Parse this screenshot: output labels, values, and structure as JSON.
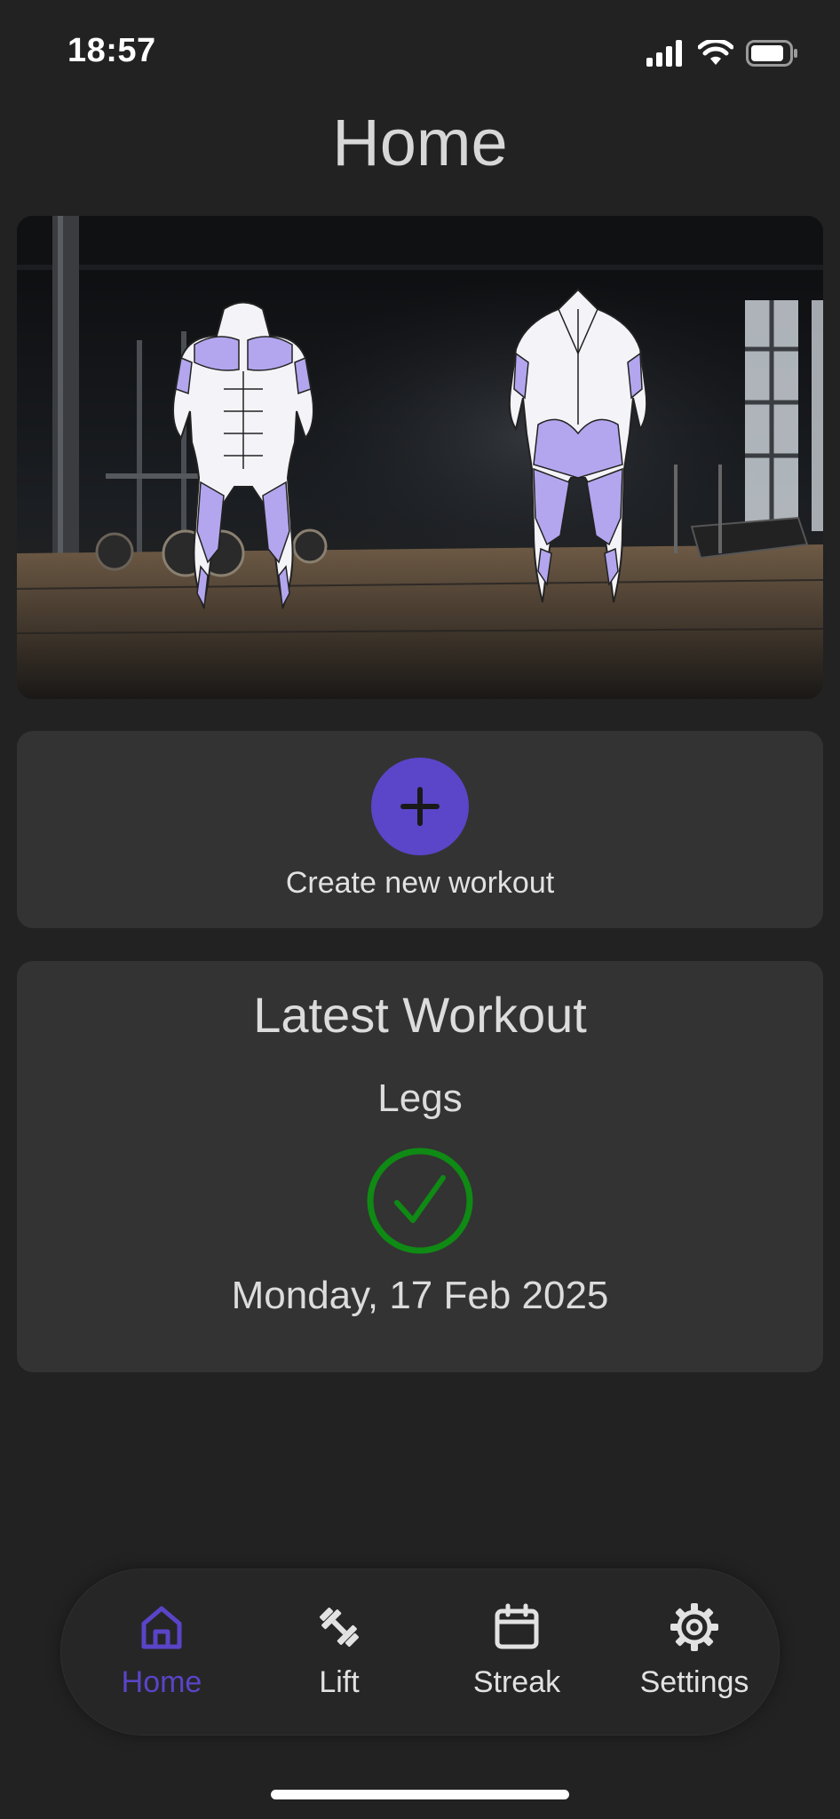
{
  "status_bar": {
    "time": "18:57"
  },
  "header": {
    "title": "Home"
  },
  "hero": {
    "image_description_icon": "muscle-map-front-back-icon"
  },
  "create_card": {
    "label": "Create new workout",
    "button_icon": "plus-icon"
  },
  "latest_workout": {
    "title": "Latest Workout",
    "name": "Legs",
    "status_icon": "check-circle-icon",
    "date": "Monday, 17 Feb 2025"
  },
  "bottom_nav": {
    "items": [
      {
        "label": "Home",
        "icon": "home-icon",
        "active": true
      },
      {
        "label": "Lift",
        "icon": "dumbbell-icon",
        "active": false
      },
      {
        "label": "Streak",
        "icon": "calendar-icon",
        "active": false
      },
      {
        "label": "Settings",
        "icon": "gear-icon",
        "active": false
      }
    ]
  },
  "colors": {
    "background": "#222222",
    "card": "#333333",
    "accent": "#5b45c9",
    "success": "#0f8a14",
    "muscle_highlight": "#b3a6ee"
  }
}
